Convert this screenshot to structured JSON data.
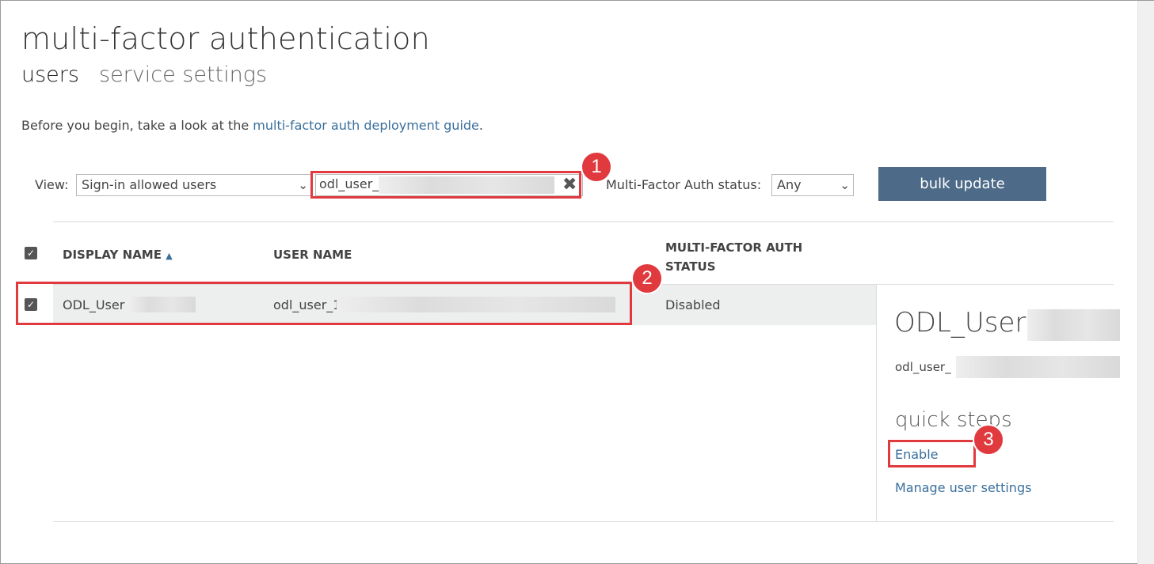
{
  "header": {
    "title": "multi-factor authentication"
  },
  "tabs": [
    {
      "label": "users"
    },
    {
      "label": "service settings"
    }
  ],
  "intro": {
    "text": "Before you begin, take a look at the ",
    "link_text": "multi-factor auth deployment guide",
    "suffix": "."
  },
  "filters": {
    "view_label": "View:",
    "view_value": "Sign-in allowed users",
    "search_value": "odl_user_",
    "mfa_status_label": "Multi-Factor Auth status:",
    "mfa_status_value": "Any",
    "bulk_update_label": "bulk update"
  },
  "table": {
    "columns": [
      "DISPLAY NAME",
      "USER NAME",
      "MULTI-FACTOR AUTH",
      "STATUS"
    ],
    "rows": [
      {
        "display_name": "ODL_User",
        "user_name": "odl_user_1",
        "status": "Disabled"
      }
    ]
  },
  "detail": {
    "name": "ODL_User",
    "username": "odl_user_",
    "quick_steps_title": "quick steps",
    "enable_label": "Enable",
    "manage_label": "Manage user settings"
  },
  "annotations": [
    "1",
    "2",
    "3"
  ],
  "colors": {
    "accent_link": "#3a6f9c",
    "button_bg": "#4d6b88",
    "highlight": "#e0393e",
    "selected_row": "#edefee"
  }
}
